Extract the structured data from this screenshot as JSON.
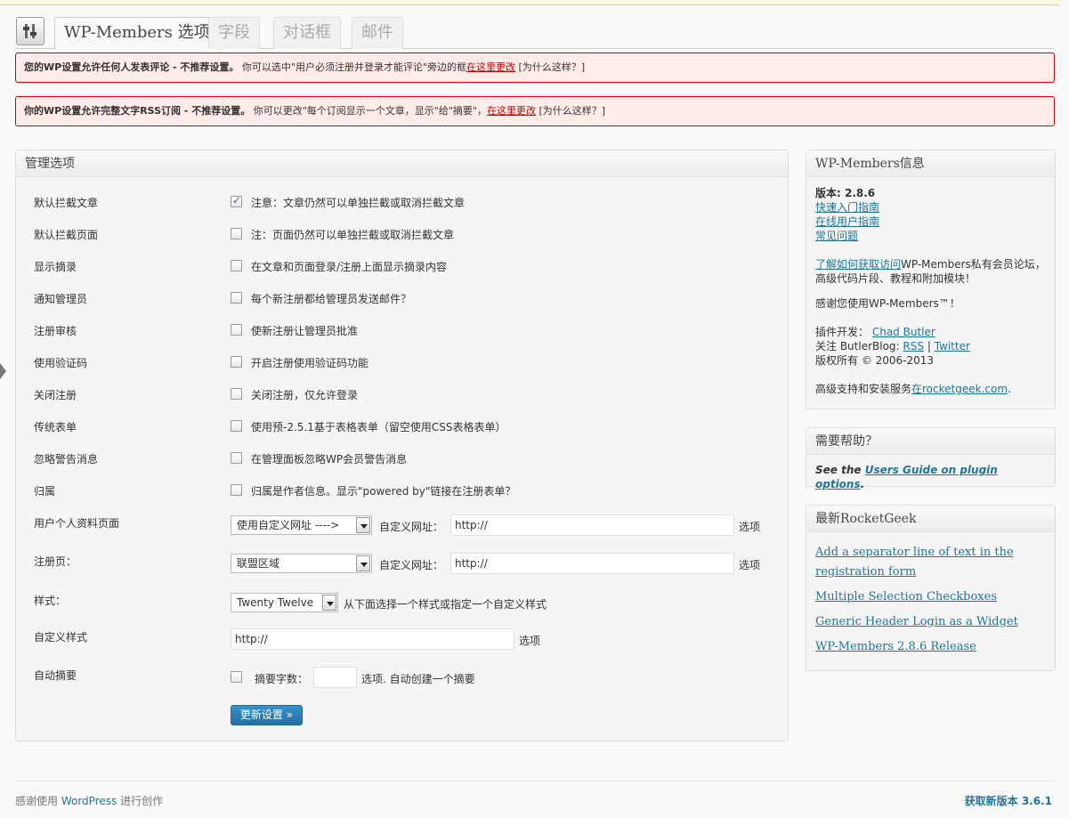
{
  "tabs": [
    {
      "label": "WP-Members 选项"
    },
    {
      "label": "字段"
    },
    {
      "label": "对话框"
    },
    {
      "label": "邮件"
    }
  ],
  "notices": [
    {
      "bold": "您的WP设置允许任何人发表评论 - 不推荐设置。",
      "text": "你可以选中\"用户必须注册并登录才能评论\"旁边的框",
      "link": "在这里更改",
      "why": " [为什么这样？]"
    },
    {
      "bold": "你的WP设置允许完整文字RSS订阅 - 不推荐设置。",
      "text": "你可以更改\"每个订阅显示一个文章，显示\"给\"摘要\"，",
      "link": "在这里更改",
      "why": " [为什么这样？]"
    }
  ],
  "manage": {
    "title": "管理选项",
    "rows": [
      {
        "label": "默认拦截文章",
        "desc": "注意：文章仍然可以单独拦截或取消拦截文章",
        "checked": true
      },
      {
        "label": "默认拦截页面",
        "desc": "注：页面仍然可以单独拦截或取消拦截文章",
        "checked": false
      },
      {
        "label": "显示摘录",
        "desc": "在文章和页面登录/注册上面显示摘录内容",
        "checked": false
      },
      {
        "label": "通知管理员",
        "desc": "每个新注册都给管理员发送邮件？",
        "checked": false
      },
      {
        "label": "注册审核",
        "desc": "使新注册让管理员批准",
        "checked": false
      },
      {
        "label": "使用验证码",
        "desc": "开启注册使用验证码功能",
        "checked": false
      },
      {
        "label": "关闭注册",
        "desc": "关闭注册，仅允许登录",
        "checked": false
      },
      {
        "label": "传统表单",
        "desc": "使用预-2.5.1基于表格表单（留空使用CSS表格表单）",
        "checked": false
      },
      {
        "label": "忽略警告消息",
        "desc": "在管理面板忽略WP会员警告消息",
        "checked": false
      },
      {
        "label": "归属",
        "desc": "归属是作者信息。显示\"powered by\"链接在注册表单？",
        "checked": false
      }
    ],
    "profile_label": "用户个人资料页面",
    "profile_select": "使用自定义网址 ---->",
    "custom_url_label": "自定义网址：",
    "profile_url": "http://",
    "option": "选项",
    "register_label": "注册页：",
    "register_select": "联盟区域",
    "register_url": "http://",
    "style_label": "样式：",
    "style_select": "Twenty Twelve",
    "style_desc": "从下面选择一个样式或指定一个自定义样式",
    "custom_style_label": "自定义样式",
    "custom_style_url": "http://",
    "auto_excerpt_label": "自动摘要",
    "excerpt_words_label": "摘要字数：",
    "excerpt_desc": "选项. 自动创建一个摘要",
    "submit": "更新设置 »"
  },
  "info": {
    "title": "WP-Members信息",
    "version": "版本: 2.8.6",
    "links": [
      "快速入门指南",
      "在线用户指南",
      "常见问题"
    ],
    "learn_link": "了解如何获取访问",
    "learn_text": "WP-Members私有会员论坛，高级代码片段、教程和附加模块！",
    "thanks": "感谢您使用WP-Members™！",
    "dev_label": "插件开发：",
    "dev_link": "Chad Butler",
    "follow_label": "关注 ButlerBlog:",
    "rss": "RSS",
    "sep": "|",
    "twitter": "Twitter",
    "copyright": "版权所有 © 2006-2013",
    "support_text": "高级支持和安装服务",
    "support_link": "在rocketgeek.com",
    "support_end": "."
  },
  "help": {
    "title": "需要帮助？",
    "see": "See the ",
    "link": "Users Guide on plugin options",
    "end": "."
  },
  "rocketgeek": {
    "title": "最新RocketGeek",
    "items": [
      "Add a separator line of text in the registration form",
      "Multiple Selection Checkboxes",
      "Generic Header Login as a Widget",
      "WP-Members 2.8.6 Release"
    ]
  },
  "footer": {
    "thanks": "感谢使用 ",
    "wp": "WordPress",
    "create": " 进行创作",
    "version": "获取新版本 3.6.1"
  },
  "colors": {
    "accent": "#21759b",
    "error_border": "#cc0000",
    "error_bg": "#ffebe8"
  }
}
